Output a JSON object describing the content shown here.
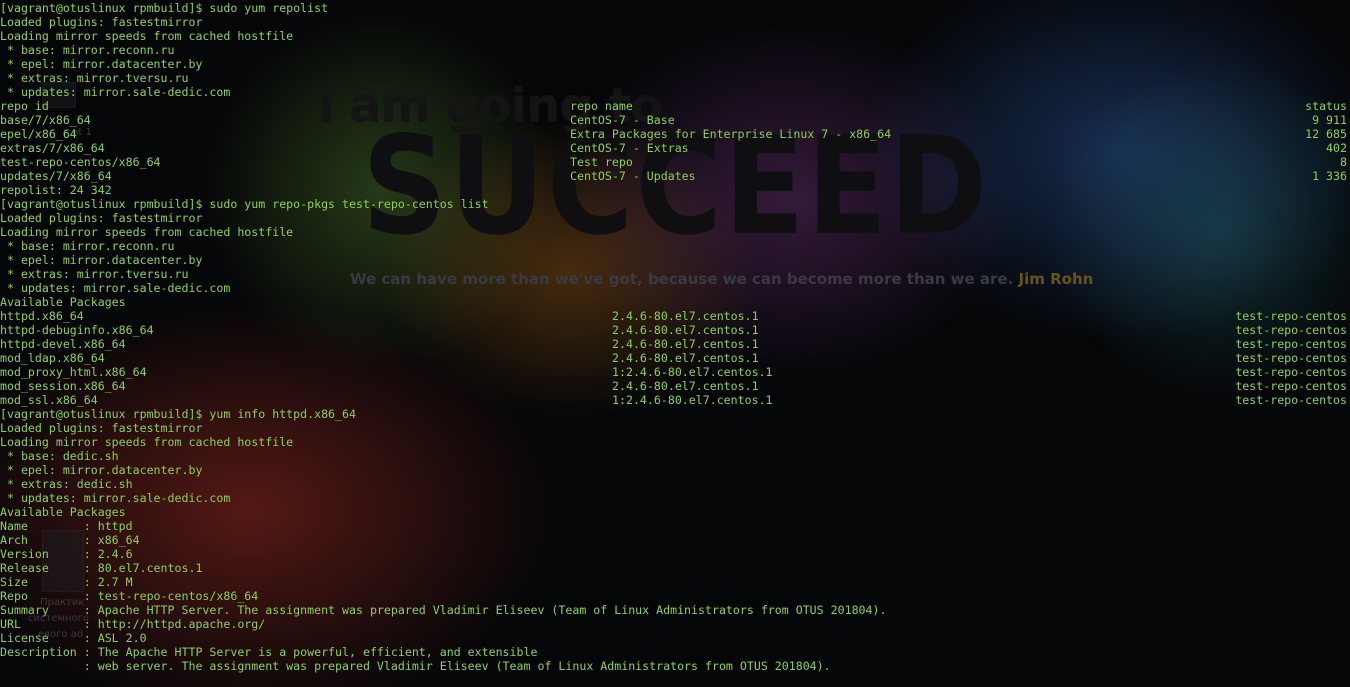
{
  "colors": {
    "terminal_text": "#8fd14f",
    "background": "#050608"
  },
  "wallpaper": {
    "headline_small": "i am going to",
    "headline_large": "SUCCEED",
    "quote": "We can have more than we've got, because we can become more than we are.",
    "quote_author": "Jim Rohn",
    "desktop_labels": [
      "nt 1",
      "Практик",
      "системного",
      "евого ad"
    ]
  },
  "terminal": {
    "block1": [
      "[vagrant@otuslinux rpmbuild]$ sudo yum repolist",
      "Loaded plugins: fastestmirror",
      "Loading mirror speeds from cached hostfile",
      " * base: mirror.reconn.ru",
      " * epel: mirror.datacenter.by",
      " * extras: mirror.tversu.ru",
      " * updates: mirror.sale-dedic.com"
    ],
    "repolist_header": {
      "id": "repo id",
      "name": "repo name",
      "status": "status"
    },
    "repolist_rows": [
      {
        "id": "base/7/x86_64",
        "name": "CentOS-7 - Base",
        "status": "9 911"
      },
      {
        "id": "epel/x86_64",
        "name": "Extra Packages for Enterprise Linux 7 - x86_64",
        "status": "12 685"
      },
      {
        "id": "extras/7/x86_64",
        "name": "CentOS-7 - Extras",
        "status": "402"
      },
      {
        "id": "test-repo-centos/x86_64",
        "name": "Test repo",
        "status": "8"
      },
      {
        "id": "updates/7/x86_64",
        "name": "CentOS-7 - Updates",
        "status": "1 336"
      }
    ],
    "repolist_total": "repolist: 24 342",
    "block2": [
      "[vagrant@otuslinux rpmbuild]$ sudo yum repo-pkgs test-repo-centos list",
      "Loaded plugins: fastestmirror",
      "Loading mirror speeds from cached hostfile",
      " * base: mirror.reconn.ru",
      " * epel: mirror.datacenter.by",
      " * extras: mirror.tversu.ru",
      " * updates: mirror.sale-dedic.com",
      "Available Packages"
    ],
    "packages": [
      {
        "name": "httpd.x86_64",
        "version": "2.4.6-80.el7.centos.1",
        "repo": "test-repo-centos"
      },
      {
        "name": "httpd-debuginfo.x86_64",
        "version": "2.4.6-80.el7.centos.1",
        "repo": "test-repo-centos"
      },
      {
        "name": "httpd-devel.x86_64",
        "version": "2.4.6-80.el7.centos.1",
        "repo": "test-repo-centos"
      },
      {
        "name": "mod_ldap.x86_64",
        "version": "2.4.6-80.el7.centos.1",
        "repo": "test-repo-centos"
      },
      {
        "name": "mod_proxy_html.x86_64",
        "version": "1:2.4.6-80.el7.centos.1",
        "repo": "test-repo-centos"
      },
      {
        "name": "mod_session.x86_64",
        "version": "2.4.6-80.el7.centos.1",
        "repo": "test-repo-centos"
      },
      {
        "name": "mod_ssl.x86_64",
        "version": "1:2.4.6-80.el7.centos.1",
        "repo": "test-repo-centos"
      }
    ],
    "block3": [
      "[vagrant@otuslinux rpmbuild]$ yum info httpd.x86_64",
      "Loaded plugins: fastestmirror",
      "Loading mirror speeds from cached hostfile",
      " * base: dedic.sh",
      " * epel: mirror.datacenter.by",
      " * extras: dedic.sh",
      " * updates: mirror.sale-dedic.com",
      "Available Packages",
      "Name        : httpd",
      "Arch        : x86_64",
      "Version     : 2.4.6",
      "Release     : 80.el7.centos.1",
      "Size        : 2.7 M",
      "Repo        : test-repo-centos/x86_64",
      "Summary     : Apache HTTP Server. The assignment was prepared Vladimir Eliseev (Team of Linux Administrators from OTUS 201804).",
      "URL         : http://httpd.apache.org/",
      "License     : ASL 2.0",
      "Description : The Apache HTTP Server is a powerful, efficient, and extensible",
      "            : web server. The assignment was prepared Vladimir Eliseev (Team of Linux Administrators from OTUS 201804)."
    ]
  }
}
